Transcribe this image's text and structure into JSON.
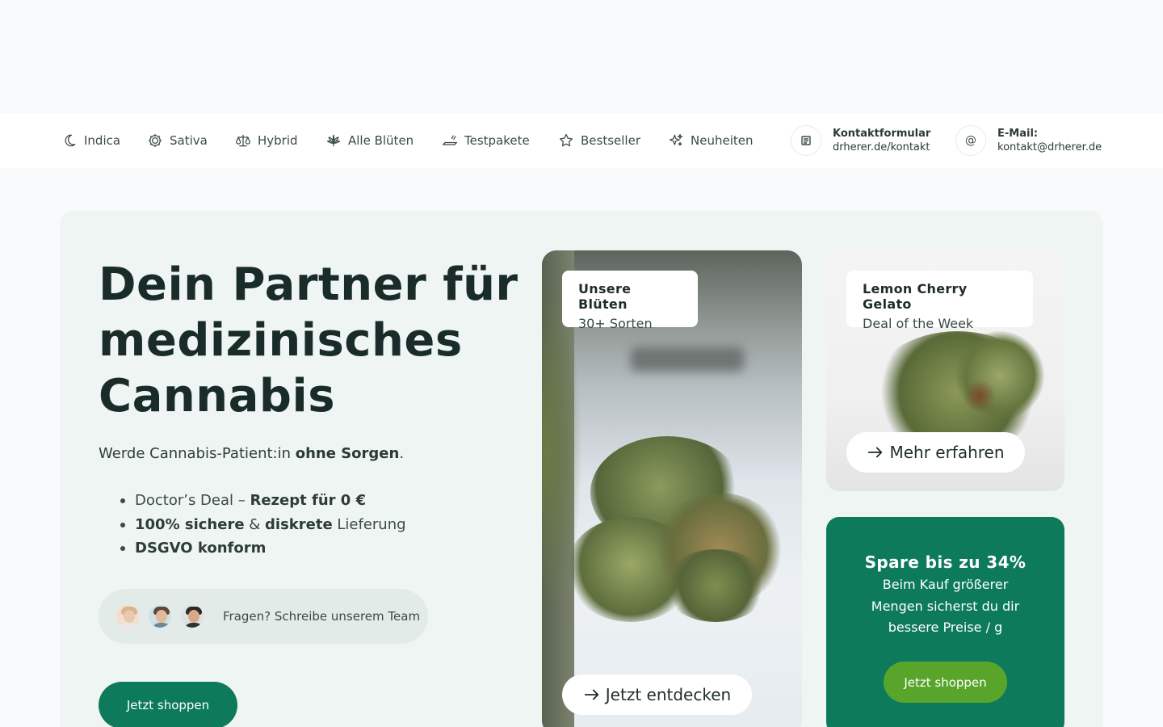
{
  "nav": {
    "items": [
      {
        "label": "Indica",
        "icon": "moon-icon"
      },
      {
        "label": "Sativa",
        "icon": "sun-icon"
      },
      {
        "label": "Hybrid",
        "icon": "scale-icon"
      },
      {
        "label": "Alle Blüten",
        "icon": "cannabis-leaf-icon"
      },
      {
        "label": "Testpakete",
        "icon": "joint-icon"
      },
      {
        "label": "Bestseller",
        "icon": "star-icon"
      },
      {
        "label": "Neuheiten",
        "icon": "sparkles-icon"
      }
    ],
    "contact_form": {
      "label": "Kontaktformular",
      "value": "drherer.de/kontakt",
      "icon": "form-icon"
    },
    "email": {
      "label": "E-Mail:",
      "value": "kontakt@drherer.de",
      "icon": "at-icon"
    }
  },
  "hero": {
    "title": "Dein Partner für medizinisches Cannabis",
    "subtitle_pre": "Werde Cannabis-Patient:in ",
    "subtitle_bold": "ohne Sorgen",
    "subtitle_post": ".",
    "bullets": [
      {
        "pre": "Doctor’s Deal – ",
        "bold": "Rezept für 0 €",
        "post": ""
      },
      {
        "bold1": "100% sichere",
        "mid": " & ",
        "bold2": "diskrete",
        "post": " Lieferung"
      },
      {
        "bold": "DSGVO konform"
      }
    ],
    "team_text": "Fragen? Schreibe unserem Team",
    "cta": "Jetzt shoppen"
  },
  "card_main": {
    "title": "Unsere Blüten",
    "subtitle": "30+ Sorten",
    "button": "Jetzt entdecken"
  },
  "card_deal": {
    "title": "Lemon Cherry Gelato",
    "subtitle": "Deal of the Week",
    "button": "Mehr erfahren"
  },
  "card_promo": {
    "title": "Spare bis zu 34%",
    "text": "Beim Kauf größerer Mengen sicherst du dir bessere Preise / g",
    "button": "Jetzt shoppen"
  },
  "colors": {
    "brand_green": "#0d7a5c",
    "accent_green": "#59a52c",
    "hero_bg": "#eff5f3",
    "text_dark": "#1a2c29"
  }
}
